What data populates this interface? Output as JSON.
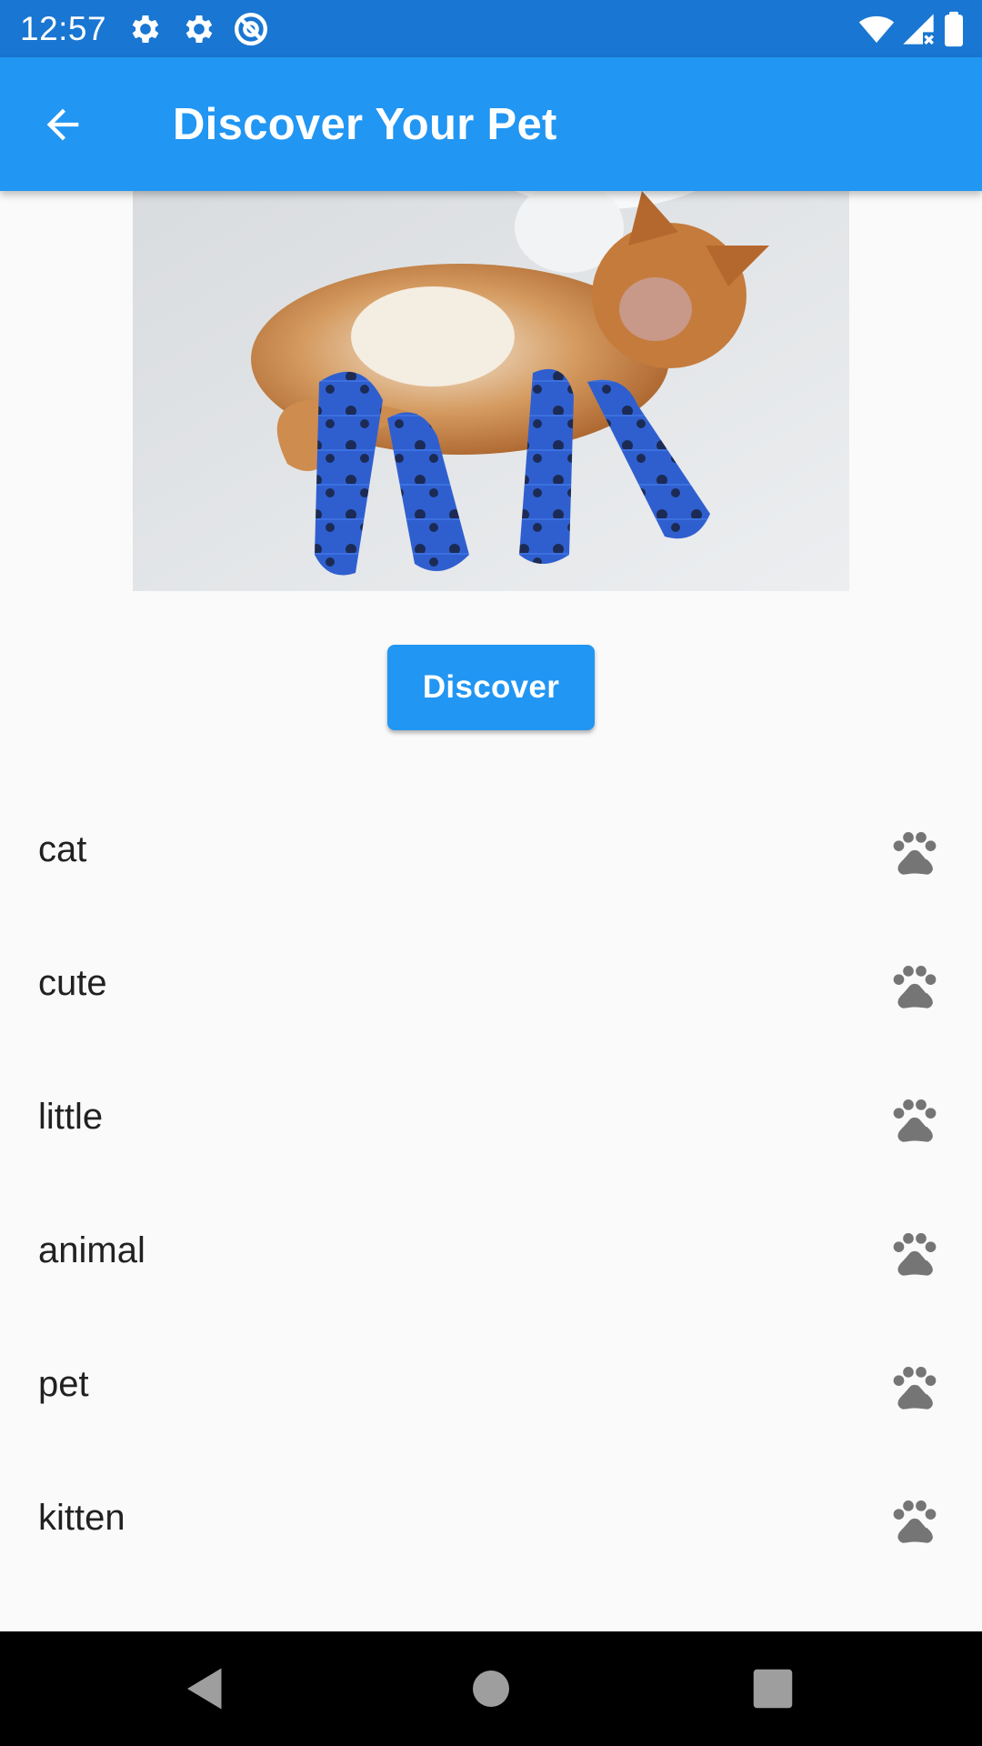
{
  "status_bar": {
    "time": "12:57",
    "left_icons": [
      "gear-icon",
      "gear-icon",
      "at-sign-icon"
    ],
    "right_icons": [
      "wifi-icon",
      "signal-icon",
      "battery-icon"
    ],
    "color": "#1976d2"
  },
  "app_bar": {
    "title": "Discover Your Pet",
    "back_icon": "arrow-back-icon",
    "color": "#2196f3"
  },
  "image": {
    "subject": "cat"
  },
  "discover_button": {
    "label": "Discover",
    "color": "#2196f3"
  },
  "tags": [
    {
      "label": "cat",
      "icon": "paw-icon"
    },
    {
      "label": "cute",
      "icon": "paw-icon"
    },
    {
      "label": "little",
      "icon": "paw-icon"
    },
    {
      "label": "animal",
      "icon": "paw-icon"
    },
    {
      "label": "pet",
      "icon": "paw-icon"
    },
    {
      "label": "kitten",
      "icon": "paw-icon"
    }
  ],
  "nav_bar": {
    "buttons": [
      "back-triangle-icon",
      "home-circle-icon",
      "recents-square-icon"
    ]
  }
}
